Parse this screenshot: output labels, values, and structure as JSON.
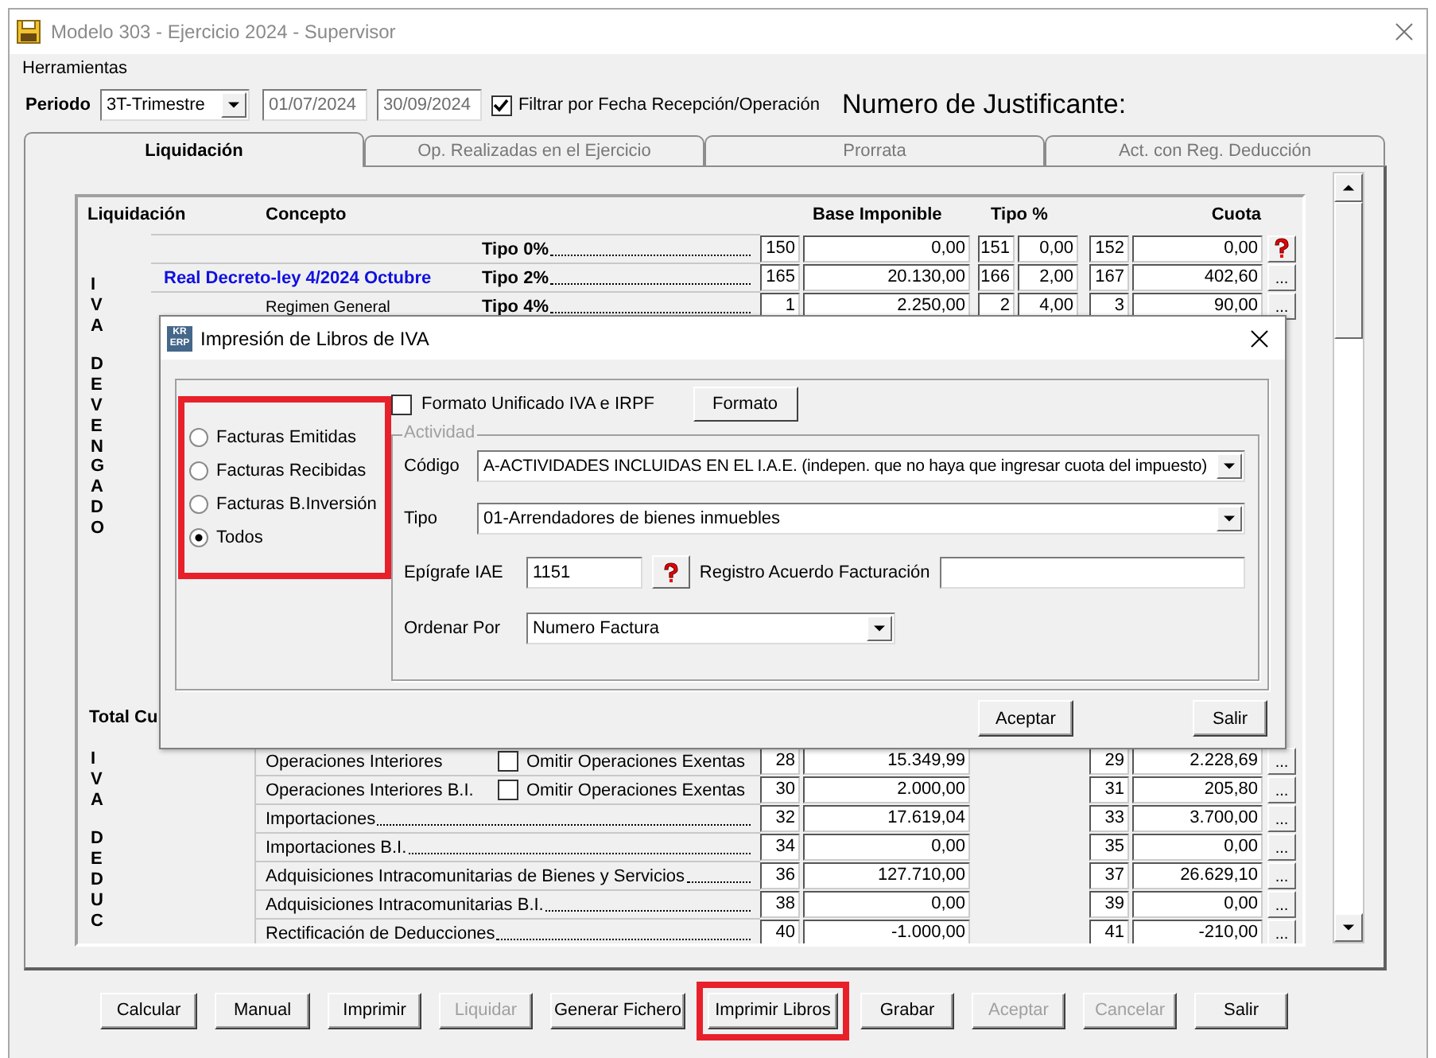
{
  "window": {
    "title": "Modelo 303 - Ejercicio 2024 - Supervisor",
    "menu": [
      "Herramientas"
    ]
  },
  "toolbar": {
    "periodo_label": "Periodo",
    "periodo": "3T-Trimestre",
    "fecha_desde": "01/07/2024",
    "fecha_hasta": "30/09/2024",
    "filtro": {
      "label": "Filtrar por Fecha Recepción/Operación",
      "checked": true
    },
    "justificante_label": "Numero de Justificante:"
  },
  "tabs": [
    {
      "label": "Liquidación",
      "selected": true
    },
    {
      "label": "Op. Realizadas en el Ejercicio",
      "selected": false
    },
    {
      "label": "Prorrata",
      "selected": false
    },
    {
      "label": "Act. con Reg. Deducción",
      "selected": false
    }
  ],
  "liquidacion": {
    "headers": {
      "section": "Liquidación",
      "concepto": "Concepto",
      "base": "Base Imponible",
      "tipo": "Tipo %",
      "cuota": "Cuota"
    },
    "devengado": {
      "letters": [
        "IVA",
        "DEVENGADO"
      ],
      "rows": [
        {
          "concept": "Tipo 0%",
          "base_box": "150",
          "base": "0,00",
          "tipo_box": "151",
          "tipo": "0,00",
          "cuota_box": "152",
          "cuota": "0,00",
          "action": {
            "kind": "help"
          }
        },
        {
          "group_title": "Real Decreto-ley 4/2024 Octubre",
          "concept": "Tipo 2%",
          "base_box": "165",
          "base": "20.130,00",
          "tipo_box": "166",
          "tipo": "2,00",
          "cuota_box": "167",
          "cuota": "402,60",
          "action": {
            "kind": "more",
            "label": "..."
          }
        },
        {
          "subgroup_title": "Regimen General",
          "concept": "Tipo 4%",
          "base_box": "1",
          "base": "2.250,00",
          "tipo_box": "2",
          "tipo": "4,00",
          "cuota_box": "3",
          "cuota": "90,00",
          "action": {
            "kind": "more",
            "label": "..."
          }
        }
      ]
    },
    "total_label": "Total Cu",
    "deducible": {
      "letters": [
        "IVA",
        "DEDUC"
      ],
      "rows": [
        {
          "concept": "Operaciones Interiores",
          "option": {
            "label": "Omitir Operaciones Exentas",
            "checked": false
          },
          "base_box": "28",
          "base": "15.349,99",
          "cuota_box": "29",
          "cuota": "2.228,69",
          "action": {
            "kind": "more",
            "label": "..."
          }
        },
        {
          "concept": "Operaciones Interiores B.I.",
          "option": {
            "label": "Omitir Operaciones Exentas",
            "checked": false
          },
          "base_box": "30",
          "base": "2.000,00",
          "cuota_box": "31",
          "cuota": "205,80",
          "action": {
            "kind": "more",
            "label": "..."
          }
        },
        {
          "concept": "Importaciones",
          "base_box": "32",
          "base": "17.619,04",
          "cuota_box": "33",
          "cuota": "3.700,00",
          "action": {
            "kind": "more",
            "label": "..."
          }
        },
        {
          "concept": "Importaciones B.I.",
          "base_box": "34",
          "base": "0,00",
          "cuota_box": "35",
          "cuota": "0,00",
          "action": {
            "kind": "more",
            "label": "..."
          }
        },
        {
          "concept": "Adquisiciones Intracomunitarias de Bienes y Servicios",
          "base_box": "36",
          "base": "127.710,00",
          "cuota_box": "37",
          "cuota": "26.629,10",
          "action": {
            "kind": "more",
            "label": "..."
          }
        },
        {
          "concept": "Adquisiciones Intracomunitarias B.I.",
          "base_box": "38",
          "base": "0,00",
          "cuota_box": "39",
          "cuota": "0,00",
          "action": {
            "kind": "more",
            "label": "..."
          }
        },
        {
          "concept": "Rectificación de Deducciones",
          "base_box": "40",
          "base": "-1.000,00",
          "cuota_box": "41",
          "cuota": "-210,00",
          "action": {
            "kind": "more",
            "label": "..."
          }
        }
      ]
    }
  },
  "buttons": [
    {
      "label": "Calcular",
      "disabled": false,
      "highlighted": false
    },
    {
      "label": "Manual",
      "disabled": false,
      "highlighted": false
    },
    {
      "label": "Imprimir",
      "disabled": false,
      "highlighted": false
    },
    {
      "label": "Liquidar",
      "disabled": true,
      "highlighted": false
    },
    {
      "label": "Generar Fichero",
      "disabled": false,
      "highlighted": false
    },
    {
      "label": "Imprimir Libros",
      "disabled": false,
      "highlighted": true
    },
    {
      "label": "Grabar",
      "disabled": false,
      "highlighted": false
    },
    {
      "label": "Aceptar",
      "disabled": true,
      "highlighted": false
    },
    {
      "label": "Cancelar",
      "disabled": true,
      "highlighted": false
    },
    {
      "label": "Salir",
      "disabled": false,
      "highlighted": false
    }
  ],
  "dialog": {
    "title": "Impresión de Libros de IVA",
    "logo": [
      "KR",
      "ERP"
    ],
    "options_highlighted": true,
    "options": [
      {
        "label": "Facturas Emitidas",
        "selected": false
      },
      {
        "label": "Facturas Recibidas",
        "selected": false
      },
      {
        "label": "Facturas B.Inversión",
        "selected": false
      },
      {
        "label": "Todos",
        "selected": true
      }
    ],
    "formato_unificado": {
      "label": "Formato Unificado IVA e IRPF",
      "checked": false
    },
    "formato_button": "Formato",
    "actividad": {
      "legend": "Actividad",
      "codigo_label": "Código",
      "codigo": "A-ACTIVIDADES INCLUIDAS EN EL I.A.E. (indepen. que no haya que ingresar cuota del impuesto)",
      "tipo_label": "Tipo",
      "tipo": "01-Arrendadores de bienes inmuebles",
      "epigrafe_label": "Epígrafe IAE",
      "epigrafe": "1151",
      "registro_label": "Registro Acuerdo Facturación",
      "ordenar_label": "Ordenar Por",
      "ordenar": "Numero Factura"
    },
    "buttons": [
      "Aceptar",
      "Salir"
    ]
  }
}
